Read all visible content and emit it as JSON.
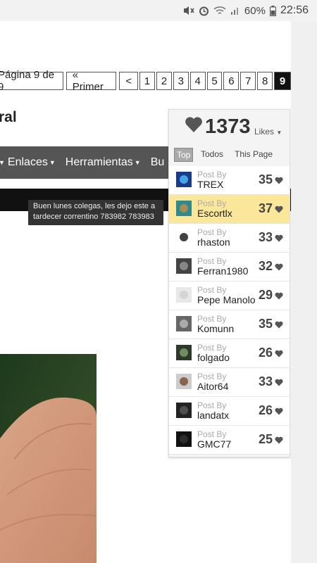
{
  "status": {
    "battery": "60%",
    "time": "22:56"
  },
  "pager": {
    "label": "Página 9 de 9",
    "first": "« Primer",
    "prev": "<",
    "pages": [
      "1",
      "2",
      "3",
      "4",
      "5",
      "6",
      "7",
      "8",
      "9"
    ],
    "current": "9"
  },
  "title": "ral",
  "nav": {
    "items": [
      {
        "label": "Enlaces"
      },
      {
        "label": "Herramientas"
      },
      {
        "label": "Bu"
      }
    ]
  },
  "tooltip": "Buen lunes colegas, les dejo este a tardecer correntino 783982 783983",
  "likes": {
    "total": "1373",
    "label": "Likes",
    "tabs": [
      "Top",
      "Todos",
      "This Page"
    ],
    "active_tab": "Top",
    "post_by": "Post By",
    "rows": [
      {
        "user": "TREX",
        "count": "35"
      },
      {
        "user": "Escortlx",
        "count": "37",
        "highlight": true
      },
      {
        "user": "rhaston",
        "count": "33"
      },
      {
        "user": "Ferran1980",
        "count": "32"
      },
      {
        "user": "Pepe Manolo",
        "count": "29"
      },
      {
        "user": "Komunn",
        "count": "35"
      },
      {
        "user": "folgado",
        "count": "26"
      },
      {
        "user": "Aitor64",
        "count": "33"
      },
      {
        "user": "landatx",
        "count": "26"
      },
      {
        "user": "GMC77",
        "count": "25"
      }
    ]
  }
}
